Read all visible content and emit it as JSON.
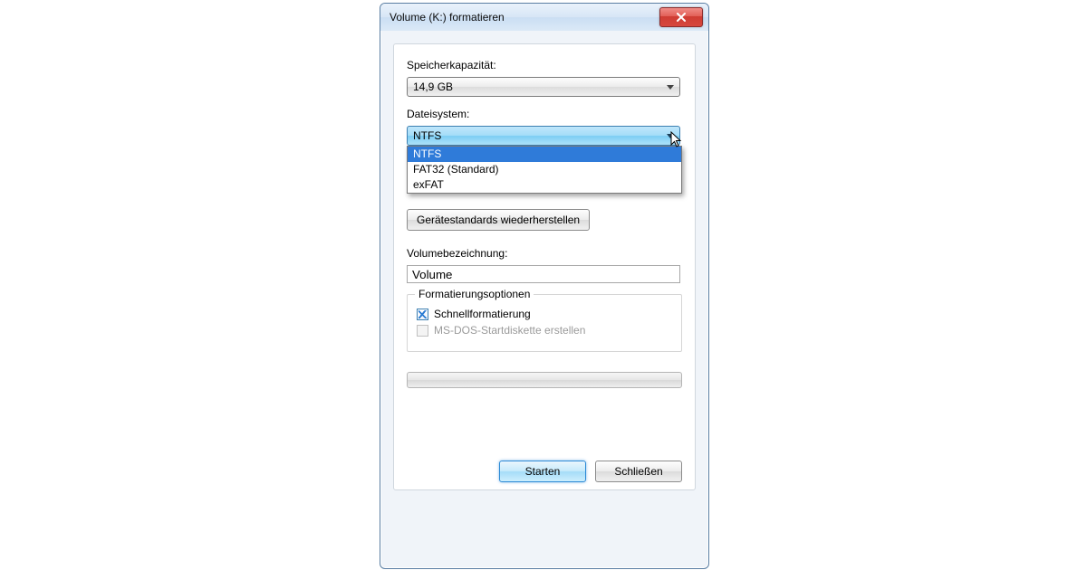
{
  "window": {
    "title": "Volume (K:) formatieren"
  },
  "capacity": {
    "label": "Speicherkapazität:",
    "value": "14,9 GB"
  },
  "filesystem": {
    "label": "Dateisystem:",
    "value": "NTFS",
    "options": [
      "NTFS",
      "FAT32 (Standard)",
      "exFAT"
    ]
  },
  "restore_button": "Gerätestandards wiederherstellen",
  "volume_label": {
    "label": "Volumebezeichnung:",
    "value": "Volume"
  },
  "options_group": {
    "title": "Formatierungsoptionen",
    "quick_format": "Schnellformatierung",
    "msdos": "MS-DOS-Startdiskette erstellen"
  },
  "footer": {
    "start": "Starten",
    "close": "Schließen"
  }
}
